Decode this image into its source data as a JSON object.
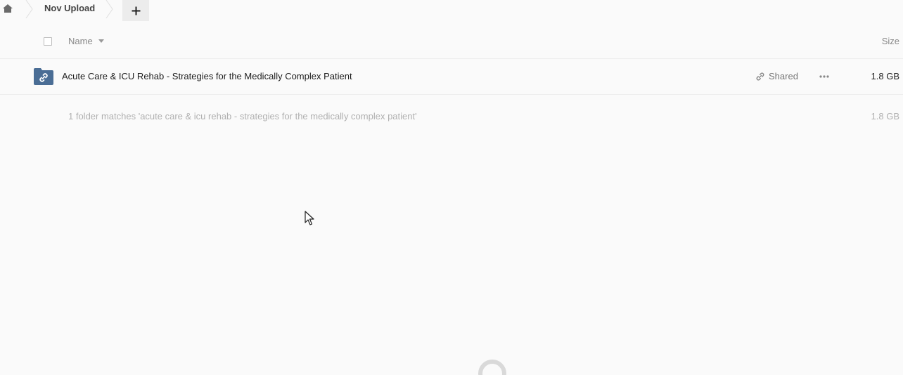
{
  "breadcrumb": {
    "home_icon": "home-icon",
    "current_folder": "Nov Upload",
    "add_button_icon": "plus-icon"
  },
  "list_header": {
    "name_label": "Name",
    "size_label": "Size",
    "sort_icon": "caret-down-icon"
  },
  "files": [
    {
      "icon": "shared-folder-icon",
      "name": "Acute Care & ICU Rehab - Strategies for the Medically Complex Patient",
      "share_label": "Shared",
      "more_icon": "more-icon",
      "size": "1.8 GB"
    }
  ],
  "summary": {
    "text": "1 folder matches 'acute care & icu rehab - strategies for the medically complex patient'",
    "size": "1.8 GB"
  },
  "colors": {
    "folder": "#4a6d95",
    "background": "#fafafa",
    "muted_text": "#b0b0b0"
  }
}
